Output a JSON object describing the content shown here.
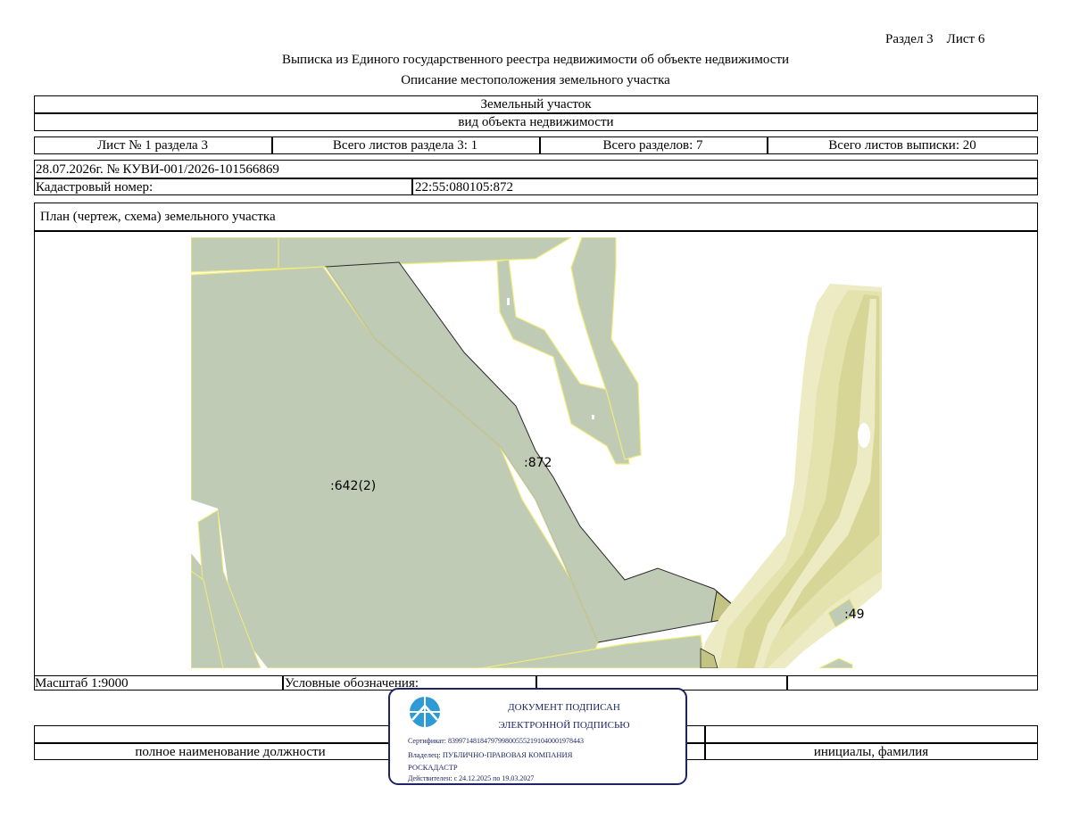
{
  "header": {
    "section_sheet": "Раздел 3    Лист 6",
    "title": "Выписка из Единого государственного реестра недвижимости об объекте недвижимости",
    "subtitle": "Описание местоположения земельного участка"
  },
  "object": {
    "type_value": "Земельный участок",
    "type_caption": "вид объекта недвижимости"
  },
  "sheet_info": {
    "sheet_number": "Лист № 1 раздела 3",
    "section_total_sheets": "Всего листов раздела 3: 1",
    "total_sections": "Всего разделов: 7",
    "total_extract_sheets": "Всего листов выписки: 20"
  },
  "record": {
    "date_number": "28.07.2026г. № КУВИ-001/2026-101566869",
    "cadastral_label": "Кадастровый номер:",
    "cadastral_value": "22:55:080105:872"
  },
  "plan": {
    "title": "План (чертеж, схема) земельного участка",
    "labels": {
      "parcel_642": ":642(2)",
      "parcel_872": ":872",
      "parcel_49": ":49"
    },
    "colors": {
      "parcel_fill": "#bfcbb5",
      "parcel_border_yellow": "#f1ec78",
      "zone_light": "#ecebc4",
      "zone_mid": "#e4e2ad",
      "zone_dark": "#d8d697",
      "highlight_fill": "#c3c383",
      "outline": "#2a2a2a"
    }
  },
  "footer": {
    "scale": "Масштаб 1:9000",
    "legend_label": "Условные обозначения:",
    "position_caption": "полное наименование должности",
    "name_caption": "инициалы, фамилия"
  },
  "stamp": {
    "line1": "ДОКУМЕНТ ПОДПИСАН",
    "line2": "ЭЛЕКТРОННОЙ ПОДПИСЬЮ",
    "certificate": "Сертификат: 839971481847979980055521910400019784​43",
    "owner_line1": "Владелец: ПУБЛИЧНО-ПРАВОВАЯ КОМПАНИЯ",
    "owner_line2": "РОСКАДАСТР",
    "valid": "Действителен: с 24.12.2025 по 19.03.2027",
    "color": "#1e2461",
    "logo_color": "#2e9ad6"
  }
}
